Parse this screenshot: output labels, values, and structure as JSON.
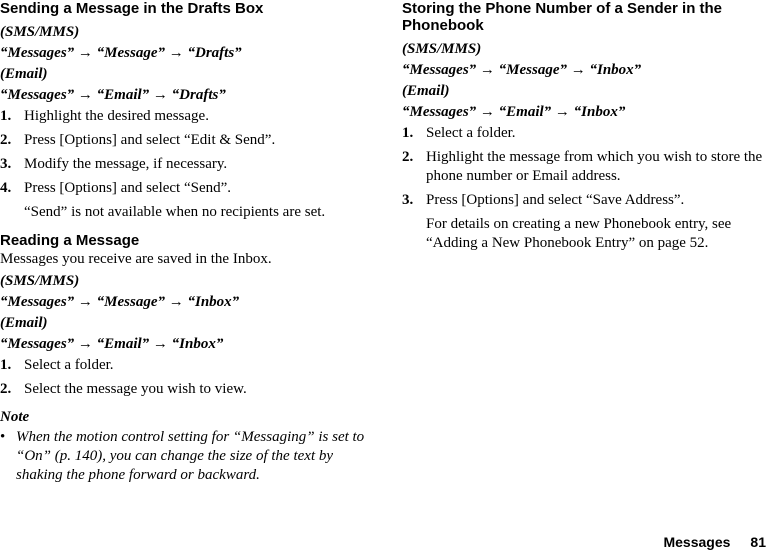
{
  "left": {
    "section1": {
      "heading": "Sending a Message in the Drafts Box",
      "sms_label": "(SMS/MMS)",
      "sms_path": "“Messages” → “Message” → “Drafts”",
      "email_label": "(Email)",
      "email_path": "“Messages” → “Email” → “Drafts”",
      "steps": [
        {
          "num": "1.",
          "text": "Highlight the desired message."
        },
        {
          "num": "2.",
          "text": "Press [Options] and select “Edit & Send”."
        },
        {
          "num": "3.",
          "text": "Modify the message, if necessary."
        },
        {
          "num": "4.",
          "text": "Press [Options] and select “Send”."
        }
      ],
      "step4_note": "“Send” is not available when no recipients are set."
    },
    "section2": {
      "heading": "Reading a Message",
      "intro": "Messages you receive are saved in the Inbox.",
      "sms_label": "(SMS/MMS)",
      "sms_path": "“Messages” → “Message” → “Inbox”",
      "email_label": "(Email)",
      "email_path": "“Messages” → “Email” → “Inbox”",
      "steps": [
        {
          "num": "1.",
          "text": "Select a folder."
        },
        {
          "num": "2.",
          "text": "Select the message you wish to view."
        }
      ]
    },
    "note": {
      "title": "Note",
      "bullet": "•",
      "text": "When the motion control setting for “Messaging” is set to “On” (p. 140), you can change the size of the text by shaking the phone forward or backward."
    }
  },
  "right": {
    "section3": {
      "heading": "Storing the Phone Number of a Sender in the Phonebook",
      "sms_label": "(SMS/MMS)",
      "sms_path": "“Messages” → “Message” → “Inbox”",
      "email_label": "(Email)",
      "email_path": "“Messages” → “Email” → “Inbox”",
      "steps": [
        {
          "num": "1.",
          "text": "Select a folder."
        },
        {
          "num": "2.",
          "text": "Highlight the message from which you wish to store the phone number or Email address."
        },
        {
          "num": "3.",
          "text": "Press [Options] and select “Save Address”."
        }
      ],
      "step3_note": "For details on creating a new Phonebook entry, see “Adding a New Phonebook Entry” on page 52."
    }
  },
  "footer": {
    "section": "Messages",
    "page": "81"
  }
}
